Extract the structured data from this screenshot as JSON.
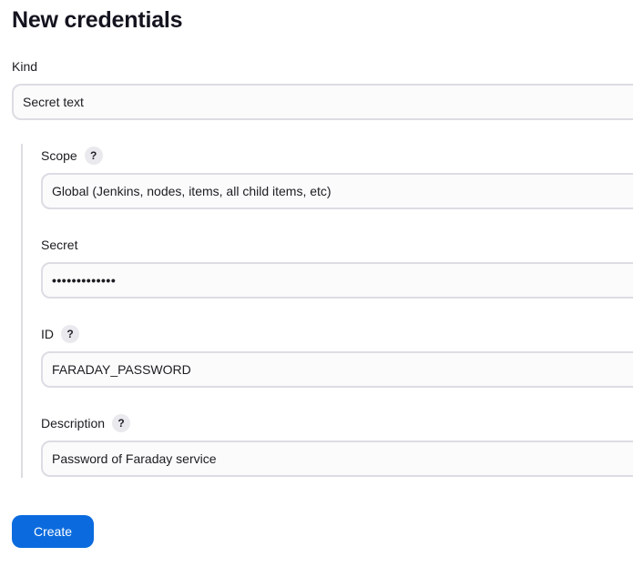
{
  "page": {
    "title": "New credentials"
  },
  "kind": {
    "label": "Kind",
    "value": "Secret text"
  },
  "scope": {
    "label": "Scope",
    "help": "?",
    "value": "Global (Jenkins, nodes, items, all child items, etc)"
  },
  "secret": {
    "label": "Secret",
    "value": "•••••••••••••"
  },
  "id": {
    "label": "ID",
    "help": "?",
    "value": "FARADAY_PASSWORD"
  },
  "description": {
    "label": "Description",
    "help": "?",
    "value": "Password of Faraday service"
  },
  "actions": {
    "create_label": "Create",
    "primary_color": "#0b6bde"
  }
}
